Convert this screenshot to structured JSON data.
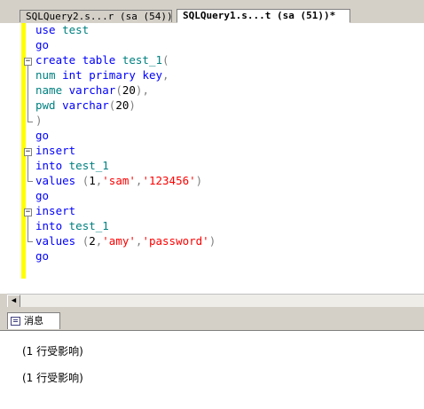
{
  "tabs": [
    {
      "label": "SQLQuery2.s...r (sa (54))"
    },
    {
      "label": "SQLQuery1.s...t (sa (51))*"
    }
  ],
  "code_lines": [
    "use test",
    "go",
    "create table test_1(",
    "num int primary key,",
    "name varchar(20),",
    "pwd varchar(20)",
    ")",
    "go",
    "insert",
    "into test_1",
    "values (1,'sam','123456')",
    "go",
    "insert",
    "into test_1",
    "values (2,'amy','password')",
    "go"
  ],
  "results_tab": {
    "label": "消息"
  },
  "messages": [
    "(1 行受影响)",
    "(1 行受影响)"
  ]
}
